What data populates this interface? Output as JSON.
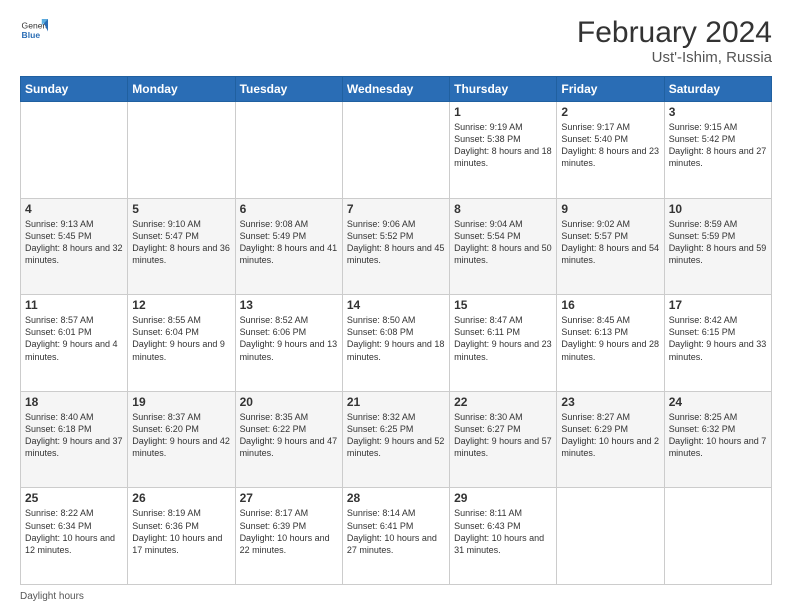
{
  "header": {
    "logo_general": "General",
    "logo_blue": "Blue",
    "month_year": "February 2024",
    "location": "Ust'-Ishim, Russia"
  },
  "days_of_week": [
    "Sunday",
    "Monday",
    "Tuesday",
    "Wednesday",
    "Thursday",
    "Friday",
    "Saturday"
  ],
  "footer": {
    "daylight_label": "Daylight hours"
  },
  "weeks": [
    [
      {
        "day": "",
        "info": ""
      },
      {
        "day": "",
        "info": ""
      },
      {
        "day": "",
        "info": ""
      },
      {
        "day": "",
        "info": ""
      },
      {
        "day": "1",
        "info": "Sunrise: 9:19 AM\nSunset: 5:38 PM\nDaylight: 8 hours\nand 18 minutes."
      },
      {
        "day": "2",
        "info": "Sunrise: 9:17 AM\nSunset: 5:40 PM\nDaylight: 8 hours\nand 23 minutes."
      },
      {
        "day": "3",
        "info": "Sunrise: 9:15 AM\nSunset: 5:42 PM\nDaylight: 8 hours\nand 27 minutes."
      }
    ],
    [
      {
        "day": "4",
        "info": "Sunrise: 9:13 AM\nSunset: 5:45 PM\nDaylight: 8 hours\nand 32 minutes."
      },
      {
        "day": "5",
        "info": "Sunrise: 9:10 AM\nSunset: 5:47 PM\nDaylight: 8 hours\nand 36 minutes."
      },
      {
        "day": "6",
        "info": "Sunrise: 9:08 AM\nSunset: 5:49 PM\nDaylight: 8 hours\nand 41 minutes."
      },
      {
        "day": "7",
        "info": "Sunrise: 9:06 AM\nSunset: 5:52 PM\nDaylight: 8 hours\nand 45 minutes."
      },
      {
        "day": "8",
        "info": "Sunrise: 9:04 AM\nSunset: 5:54 PM\nDaylight: 8 hours\nand 50 minutes."
      },
      {
        "day": "9",
        "info": "Sunrise: 9:02 AM\nSunset: 5:57 PM\nDaylight: 8 hours\nand 54 minutes."
      },
      {
        "day": "10",
        "info": "Sunrise: 8:59 AM\nSunset: 5:59 PM\nDaylight: 8 hours\nand 59 minutes."
      }
    ],
    [
      {
        "day": "11",
        "info": "Sunrise: 8:57 AM\nSunset: 6:01 PM\nDaylight: 9 hours\nand 4 minutes."
      },
      {
        "day": "12",
        "info": "Sunrise: 8:55 AM\nSunset: 6:04 PM\nDaylight: 9 hours\nand 9 minutes."
      },
      {
        "day": "13",
        "info": "Sunrise: 8:52 AM\nSunset: 6:06 PM\nDaylight: 9 hours\nand 13 minutes."
      },
      {
        "day": "14",
        "info": "Sunrise: 8:50 AM\nSunset: 6:08 PM\nDaylight: 9 hours\nand 18 minutes."
      },
      {
        "day": "15",
        "info": "Sunrise: 8:47 AM\nSunset: 6:11 PM\nDaylight: 9 hours\nand 23 minutes."
      },
      {
        "day": "16",
        "info": "Sunrise: 8:45 AM\nSunset: 6:13 PM\nDaylight: 9 hours\nand 28 minutes."
      },
      {
        "day": "17",
        "info": "Sunrise: 8:42 AM\nSunset: 6:15 PM\nDaylight: 9 hours\nand 33 minutes."
      }
    ],
    [
      {
        "day": "18",
        "info": "Sunrise: 8:40 AM\nSunset: 6:18 PM\nDaylight: 9 hours\nand 37 minutes."
      },
      {
        "day": "19",
        "info": "Sunrise: 8:37 AM\nSunset: 6:20 PM\nDaylight: 9 hours\nand 42 minutes."
      },
      {
        "day": "20",
        "info": "Sunrise: 8:35 AM\nSunset: 6:22 PM\nDaylight: 9 hours\nand 47 minutes."
      },
      {
        "day": "21",
        "info": "Sunrise: 8:32 AM\nSunset: 6:25 PM\nDaylight: 9 hours\nand 52 minutes."
      },
      {
        "day": "22",
        "info": "Sunrise: 8:30 AM\nSunset: 6:27 PM\nDaylight: 9 hours\nand 57 minutes."
      },
      {
        "day": "23",
        "info": "Sunrise: 8:27 AM\nSunset: 6:29 PM\nDaylight: 10 hours\nand 2 minutes."
      },
      {
        "day": "24",
        "info": "Sunrise: 8:25 AM\nSunset: 6:32 PM\nDaylight: 10 hours\nand 7 minutes."
      }
    ],
    [
      {
        "day": "25",
        "info": "Sunrise: 8:22 AM\nSunset: 6:34 PM\nDaylight: 10 hours\nand 12 minutes."
      },
      {
        "day": "26",
        "info": "Sunrise: 8:19 AM\nSunset: 6:36 PM\nDaylight: 10 hours\nand 17 minutes."
      },
      {
        "day": "27",
        "info": "Sunrise: 8:17 AM\nSunset: 6:39 PM\nDaylight: 10 hours\nand 22 minutes."
      },
      {
        "day": "28",
        "info": "Sunrise: 8:14 AM\nSunset: 6:41 PM\nDaylight: 10 hours\nand 27 minutes."
      },
      {
        "day": "29",
        "info": "Sunrise: 8:11 AM\nSunset: 6:43 PM\nDaylight: 10 hours\nand 31 minutes."
      },
      {
        "day": "",
        "info": ""
      },
      {
        "day": "",
        "info": ""
      }
    ]
  ]
}
